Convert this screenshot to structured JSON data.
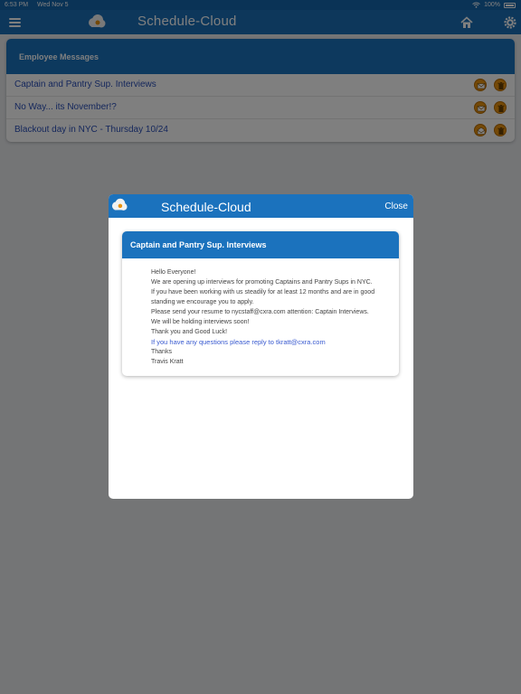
{
  "status_bar": {
    "time": "6:53 PM",
    "date": "Wed Nov 5",
    "battery": "100%"
  },
  "nav": {
    "title": "Schedule-Cloud",
    "icons": [
      "menu-icon",
      "cloud-logo-icon",
      "home-icon",
      "gear-icon"
    ]
  },
  "messages_panel": {
    "header": "Employee Messages",
    "items": [
      {
        "subject": "Captain and Pantry Sup. Interviews"
      },
      {
        "subject": "No Way... its November!?"
      },
      {
        "subject": "Blackout day in NYC - Thursday 10/24"
      }
    ]
  },
  "modal": {
    "title": "Schedule-Cloud",
    "close_label": "Close",
    "message": {
      "subject": "Captain and Pantry Sup. Interviews",
      "line1": "Hello Everyone!",
      "line2": "We are opening up interviews for promoting Captains and Pantry Sups in NYC.",
      "line3": "If you have been working with us steadily for at least 12 months and are in good standing we encourage you to apply.",
      "line4": "Please send your resume to  nycstaff@cxra.com  attention:  Captain Interviews.",
      "line5": "We will be holding interviews soon!",
      "line6": "Thank you and Good Luck!",
      "line7": "If you have any questions please reply to tkratt@cxra.com",
      "line8": "Thanks",
      "line9": "Travis Kratt"
    }
  },
  "colors": {
    "nav_blue": "#1b6fb7",
    "header_blue": "#1b72bd",
    "link_blue": "#2a4fb8",
    "accent_orange": "#e8920f"
  }
}
